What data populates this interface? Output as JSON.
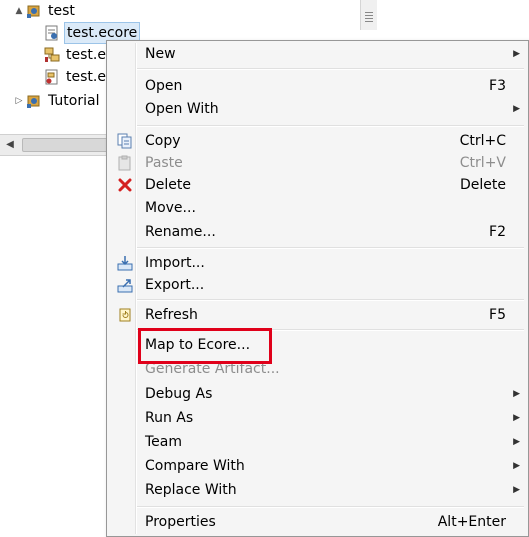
{
  "tree": {
    "items": [
      {
        "label": "test",
        "twisty": "▲",
        "icon": "project-icon"
      },
      {
        "label": "test.ecore",
        "icon": "ecore-file-icon",
        "selected": true
      },
      {
        "label": "test.er",
        "icon": "er-file-icon"
      },
      {
        "label": "test.er",
        "icon": "er-diagram-icon"
      },
      {
        "label": "Tutorial",
        "twisty": "▷",
        "icon": "project-icon"
      }
    ]
  },
  "hscroll": {
    "left_arrow": "◀"
  },
  "context_menu": {
    "new": {
      "label": "New",
      "submenu": "▶"
    },
    "open": {
      "label": "Open",
      "shortcut": "F3"
    },
    "open_with": {
      "label": "Open With",
      "submenu": "▶"
    },
    "copy": {
      "label": "Copy",
      "shortcut": "Ctrl+C"
    },
    "paste": {
      "label": "Paste",
      "shortcut": "Ctrl+V"
    },
    "delete": {
      "label": "Delete",
      "shortcut": "Delete"
    },
    "move": {
      "label": "Move..."
    },
    "rename": {
      "label": "Rename...",
      "shortcut": "F2"
    },
    "import": {
      "label": "Import..."
    },
    "export": {
      "label": "Export..."
    },
    "refresh": {
      "label": "Refresh",
      "shortcut": "F5"
    },
    "map_to_ecore": {
      "label": "Map to Ecore..."
    },
    "generate_artifact": {
      "label": "Generate Artifact..."
    },
    "debug_as": {
      "label": "Debug As",
      "submenu": "▶"
    },
    "run_as": {
      "label": "Run As",
      "submenu": "▶"
    },
    "team": {
      "label": "Team",
      "submenu": "▶"
    },
    "compare_with": {
      "label": "Compare With",
      "submenu": "▶"
    },
    "replace_with": {
      "label": "Replace With",
      "submenu": "▶"
    },
    "properties": {
      "label": "Properties",
      "shortcut": "Alt+Enter"
    }
  },
  "colors": {
    "highlight": "#e0001a",
    "menu_bg": "#f5f5f5",
    "selection": "#dbeaf8"
  }
}
